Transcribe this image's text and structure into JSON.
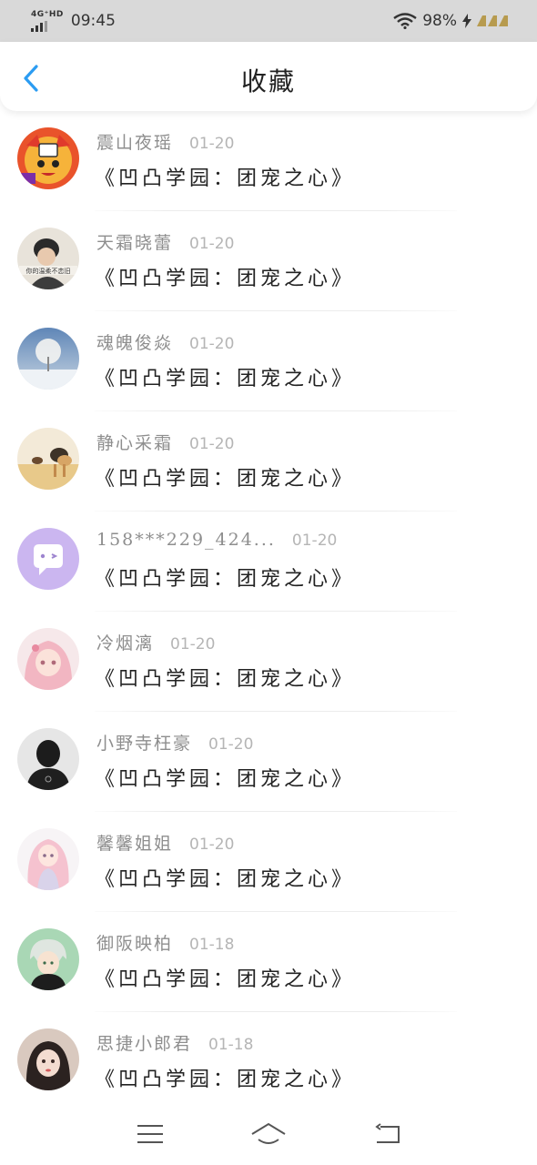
{
  "status": {
    "network": "4G⁺HD",
    "time": "09:45",
    "battery": "98%"
  },
  "header": {
    "title": "收藏",
    "back_icon": "chevron-left-icon",
    "accent": "#2b9cf2"
  },
  "items": [
    {
      "name": "震山夜瑶",
      "date": "01-20",
      "title": "《凹凸学园：团宠之心》"
    },
    {
      "name": "天霜晓蕾",
      "date": "01-20",
      "title": "《凹凸学园：团宠之心》"
    },
    {
      "name": "魂魄俊焱",
      "date": "01-20",
      "title": "《凹凸学园：团宠之心》"
    },
    {
      "name": "静心采霜",
      "date": "01-20",
      "title": "《凹凸学园：团宠之心》"
    },
    {
      "name": "158***229_424...",
      "date": "01-20",
      "title": "《凹凸学园：团宠之心》"
    },
    {
      "name": "冷烟漓",
      "date": "01-20",
      "title": "《凹凸学园：团宠之心》"
    },
    {
      "name": "小野寺枉豪",
      "date": "01-20",
      "title": "《凹凸学园：团宠之心》"
    },
    {
      "name": "馨馨姐姐",
      "date": "01-20",
      "title": "《凹凸学园：团宠之心》"
    },
    {
      "name": "御阪映柏",
      "date": "01-18",
      "title": "《凹凸学园：团宠之心》"
    },
    {
      "name": "思捷小郎君",
      "date": "01-18",
      "title": "《凹凸学园：团宠之心》"
    }
  ],
  "avatar_2_caption": "你的温柔不恋旧",
  "navbar": {
    "menu_icon": "menu-icon",
    "home_icon": "home-icon",
    "back_icon": "back-icon"
  }
}
